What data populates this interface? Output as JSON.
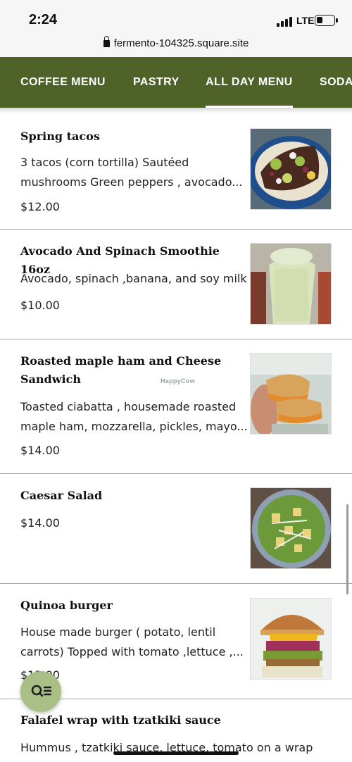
{
  "status_bar": {
    "time": "2:24",
    "network": "LTE"
  },
  "browser": {
    "url": "fermento-104325.square.site"
  },
  "nav": {
    "tabs": [
      {
        "label": "COFFEE MENU"
      },
      {
        "label": "PASTRY"
      },
      {
        "label": "ALL DAY MENU",
        "active": true
      },
      {
        "label": "SODA"
      }
    ],
    "background_color": "#4f6228"
  },
  "menu_items": [
    {
      "title": "Spring tacos",
      "desc1": "3 tacos (corn tortilla) Sautéed",
      "desc2": "mushrooms Green peppers , avocado...",
      "price": "$12.00"
    },
    {
      "title": "Avocado And Spinach Smoothie 16oz",
      "desc1": "Avocado, spinach ,banana, and soy milk",
      "price": "$10.00"
    },
    {
      "title1": "Roasted maple ham and Cheese",
      "title2": "Sandwich",
      "desc1": "Toasted ciabatta , housemade roasted",
      "desc2": "maple ham, mozzarella, pickles, mayo...",
      "price": "$14.00"
    },
    {
      "title": "Caesar Salad",
      "price": "$14.00"
    },
    {
      "title": "Quinoa burger",
      "desc1": "House made burger ( potato, lentil",
      "desc2": "carrots) Topped with tomato ,lettuce ,...",
      "price": "$13.00"
    },
    {
      "title": "Falafel wrap with tzatkiki sauce",
      "desc1": "Hummus , tzatkiki sauce, lettuce, tomato on a wrap"
    }
  ],
  "watermark": "HappyCow",
  "colors": {
    "accent": "#4f6228",
    "fab": "#a9bf86"
  }
}
